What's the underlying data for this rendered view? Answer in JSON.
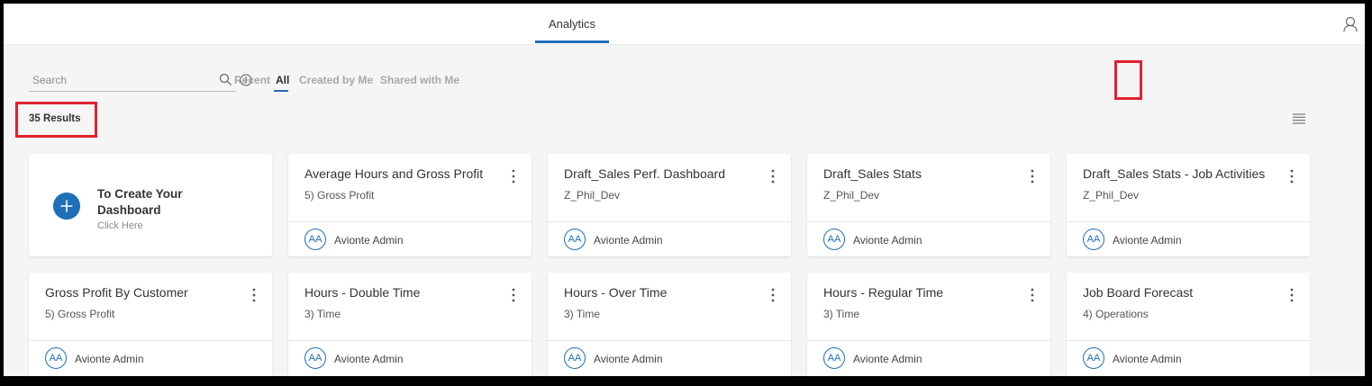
{
  "header": {
    "tab": "Analytics"
  },
  "search": {
    "placeholder": "Search"
  },
  "filters": {
    "recent": "Recent",
    "all": "All",
    "created_by_me": "Created by Me",
    "shared_with_me": "Shared with Me"
  },
  "results_label": "35 Results",
  "create_card": {
    "title": "To Create Your Dashboard",
    "subtitle": "Click Here"
  },
  "cards": [
    {
      "title": "Average Hours and Gross Profit",
      "category": "5) Gross Profit",
      "initials": "AA",
      "owner": "Avionte Admin"
    },
    {
      "title": "Draft_Sales Perf. Dashboard",
      "category": "Z_Phil_Dev",
      "initials": "AA",
      "owner": "Avionte Admin"
    },
    {
      "title": "Draft_Sales Stats",
      "category": "Z_Phil_Dev",
      "initials": "AA",
      "owner": "Avionte Admin"
    },
    {
      "title": "Draft_Sales Stats - Job Activities",
      "category": "Z_Phil_Dev",
      "initials": "AA",
      "owner": "Avionte Admin"
    },
    {
      "title": "Gross Profit By Customer",
      "category": "5) Gross Profit",
      "initials": "AA",
      "owner": "Avionte Admin"
    },
    {
      "title": "Hours - Double Time",
      "category": "3) Time",
      "initials": "AA",
      "owner": "Avionte Admin"
    },
    {
      "title": "Hours - Over Time",
      "category": "3) Time",
      "initials": "AA",
      "owner": "Avionte Admin"
    },
    {
      "title": "Hours - Regular Time",
      "category": "3) Time",
      "initials": "AA",
      "owner": "Avionte Admin"
    },
    {
      "title": "Job Board Forecast",
      "category": "4) Operations",
      "initials": "AA",
      "owner": "Avionte Admin"
    }
  ],
  "colors": {
    "accent": "#1f6fb8",
    "highlight": "#e2202e"
  }
}
